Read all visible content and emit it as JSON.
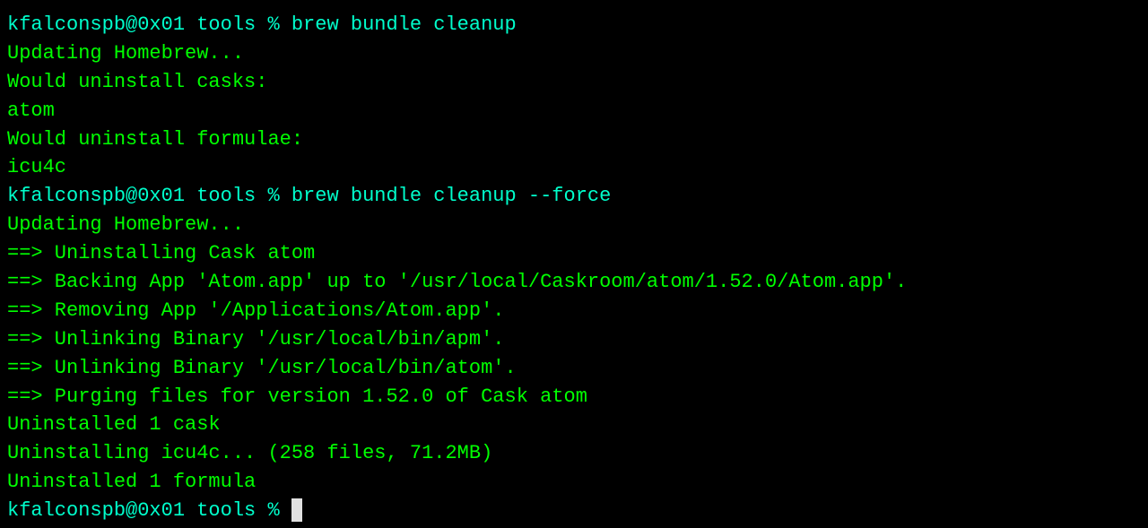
{
  "terminal": {
    "lines": [
      {
        "id": "line1",
        "text": "kfalconspb@0x01 tools % brew bundle cleanup",
        "color": "cyan"
      },
      {
        "id": "line2",
        "text": "Updating Homebrew...",
        "color": "green"
      },
      {
        "id": "line3",
        "text": "Would uninstall casks:",
        "color": "green"
      },
      {
        "id": "line4",
        "text": "atom",
        "color": "green"
      },
      {
        "id": "line5",
        "text": "Would uninstall formulae:",
        "color": "green"
      },
      {
        "id": "line6",
        "text": "icu4c",
        "color": "green"
      },
      {
        "id": "line7",
        "text": "kfalconspb@0x01 tools % brew bundle cleanup --force",
        "color": "cyan"
      },
      {
        "id": "line8",
        "text": "Updating Homebrew...",
        "color": "green"
      },
      {
        "id": "line9",
        "text": "==> Uninstalling Cask atom",
        "color": "green"
      },
      {
        "id": "line10",
        "text": "==> Backing App 'Atom.app' up to '/usr/local/Caskroom/atom/1.52.0/Atom.app'.",
        "color": "green"
      },
      {
        "id": "line11",
        "text": "==> Removing App '/Applications/Atom.app'.",
        "color": "green"
      },
      {
        "id": "line12",
        "text": "==> Unlinking Binary '/usr/local/bin/apm'.",
        "color": "green"
      },
      {
        "id": "line13",
        "text": "==> Unlinking Binary '/usr/local/bin/atom'.",
        "color": "green"
      },
      {
        "id": "line14",
        "text": "==> Purging files for version 1.52.0 of Cask atom",
        "color": "green"
      },
      {
        "id": "line15",
        "text": "Uninstalled 1 cask",
        "color": "green"
      },
      {
        "id": "line16",
        "text": "Uninstalling icu4c... (258 files, 71.2MB)",
        "color": "green"
      },
      {
        "id": "line17",
        "text": "Uninstalled 1 formula",
        "color": "green"
      },
      {
        "id": "line18",
        "text": "kfalconspb@0x01 tools % ",
        "color": "cyan",
        "cursor": true
      }
    ]
  }
}
